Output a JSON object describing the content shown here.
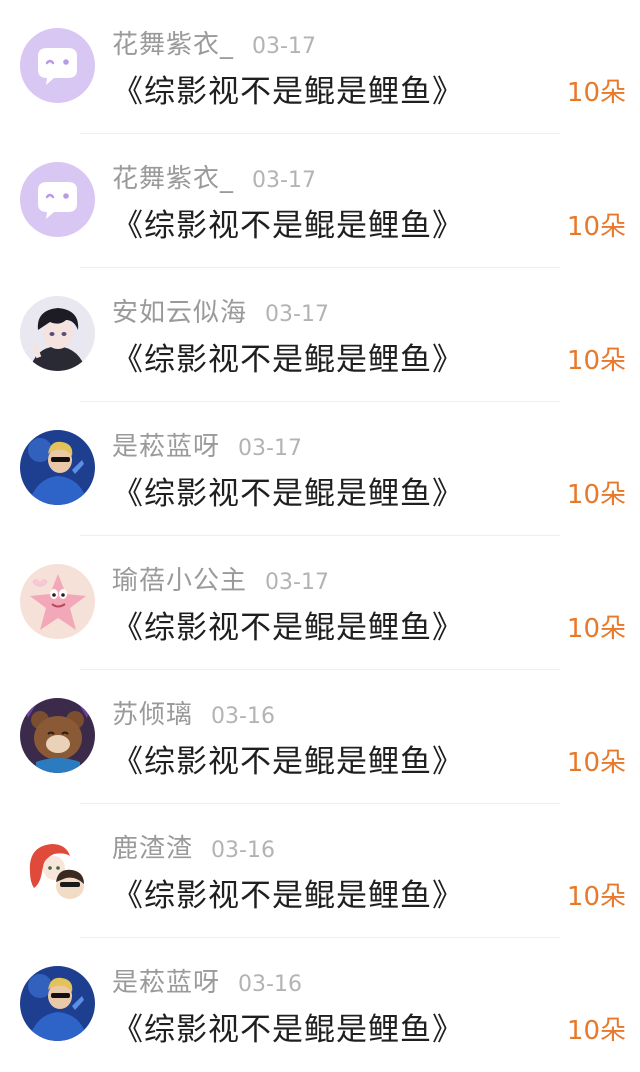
{
  "gift_color": "#e8792b",
  "items": [
    {
      "username": "花舞紫衣_",
      "date": "03-17",
      "title": "《综影视不是鲲是鲤鱼》",
      "gift": "10朵",
      "avatar": "chat-bubble-avatar-icon"
    },
    {
      "username": "花舞紫衣_",
      "date": "03-17",
      "title": "《综影视不是鲲是鲤鱼》",
      "gift": "10朵",
      "avatar": "chat-bubble-avatar-icon"
    },
    {
      "username": "安如云似海",
      "date": "03-17",
      "title": "《综影视不是鲲是鲤鱼》",
      "gift": "10朵",
      "avatar": "anime-boy-avatar"
    },
    {
      "username": "是菘蓝呀",
      "date": "03-17",
      "title": "《综影视不是鲲是鲤鱼》",
      "gift": "10朵",
      "avatar": "blue-character-avatar"
    },
    {
      "username": "瑜蓓小公主",
      "date": "03-17",
      "title": "《综影视不是鲲是鲤鱼》",
      "gift": "10朵",
      "avatar": "pink-starfish-avatar"
    },
    {
      "username": "苏倾璃",
      "date": "03-16",
      "title": "《综影视不是鲲是鲤鱼》",
      "gift": "10朵",
      "avatar": "brown-bear-avatar"
    },
    {
      "username": "鹿渣渣",
      "date": "03-16",
      "title": "《综影视不是鲲是鲤鱼》",
      "gift": "10朵",
      "avatar": "red-hair-girl-avatar"
    },
    {
      "username": "是菘蓝呀",
      "date": "03-16",
      "title": "《综影视不是鲲是鲤鱼》",
      "gift": "10朵",
      "avatar": "blue-character-avatar"
    }
  ]
}
